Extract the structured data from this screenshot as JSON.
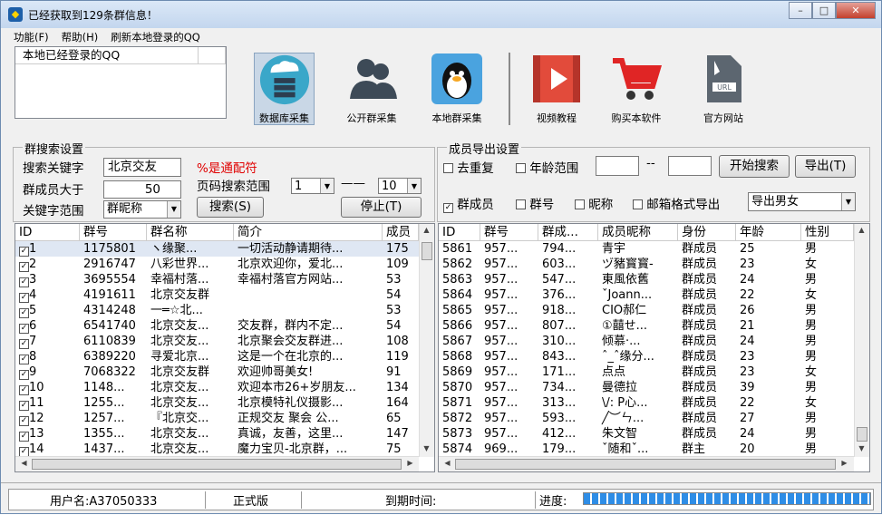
{
  "window": {
    "title": "已经获取到129条群信息！",
    "min": "–",
    "max": "□",
    "close": "✕"
  },
  "menu": [
    "功能(F)",
    "帮助(H)",
    "刷新本地登录的QQ"
  ],
  "logged_header": "本地已经登录的QQ",
  "tools": [
    {
      "label": "数据库采集",
      "icon": "database-cloud-icon"
    },
    {
      "label": "公开群采集",
      "icon": "people-icon"
    },
    {
      "label": "本地群采集",
      "icon": "qq-penguin-icon"
    },
    {
      "label": "视频教程",
      "icon": "video-play-icon"
    },
    {
      "label": "购买本软件",
      "icon": "shopping-cart-icon"
    },
    {
      "label": "官方网站",
      "icon": "url-document-icon"
    }
  ],
  "search": {
    "group_title": "群搜索设置",
    "keyword_label": "搜索关键字",
    "keyword_value": "北京交友",
    "wildcard_note": "%是通配符",
    "members_label": "群成员大于",
    "members_value": "50",
    "page_label": "页码搜索范围",
    "page_from": "1",
    "page_dash": "——",
    "page_to": "10",
    "scope_label": "关键字范围",
    "scope_value": "群昵称",
    "search_btn": "搜索(S)",
    "stop_btn": "停止(T)"
  },
  "export": {
    "group_title": "成员导出设置",
    "dedupe_label": "去重复",
    "age_label": "年龄范围",
    "age_from": "",
    "age_dash": "--",
    "age_to": "",
    "start_btn": "开始搜索",
    "export_btn": "导出(T)",
    "chk_member": "群成员",
    "chk_group": "群号",
    "chk_nick": "昵称",
    "chk_email": "邮箱格式导出",
    "gender_value": "导出男女"
  },
  "left_table": {
    "headers": [
      "ID",
      "群号",
      "群名称",
      "简介",
      "成员"
    ],
    "rows": [
      [
        "1",
        "1175801",
        "ヽ缘聚...",
        "一切活动静请期待...",
        "175"
      ],
      [
        "2",
        "2916747",
        "八彩世界...",
        "北京欢迎你，爱北...",
        "109"
      ],
      [
        "3",
        "3695554",
        "幸福村落...",
        "幸福村落官方网站...",
        "53"
      ],
      [
        "4",
        "4191611",
        "北京交友群",
        "",
        "54"
      ],
      [
        "5",
        "4314248",
        "一═☆北...",
        "",
        "53"
      ],
      [
        "6",
        "6541740",
        "北京交友...",
        "交友群，群内不定...",
        "54"
      ],
      [
        "7",
        "6110839",
        "北京交友...",
        "北京聚会交友群进...",
        "108"
      ],
      [
        "8",
        "6389220",
        "寻爱北京...",
        "这是一个在北京的...",
        "119"
      ],
      [
        "9",
        "7068322",
        "北京交友群",
        "欢迎帅哥美女!",
        "91"
      ],
      [
        "10",
        "1148...",
        "北京交友...",
        "欢迎本市26+岁朋友...",
        "134"
      ],
      [
        "11",
        "1255...",
        "北京交友...",
        "北京模特礼仪摄影...",
        "164"
      ],
      [
        "12",
        "1257...",
        "『北京交...",
        "正规交友 聚会 公...",
        "65"
      ],
      [
        "13",
        "1355...",
        "北京交友...",
        "真诚，友善，这里...",
        "147"
      ],
      [
        "14",
        "1437...",
        "北京交友...",
        "魔力宝贝-北京群，...",
        "75"
      ]
    ]
  },
  "right_table": {
    "headers": [
      "ID",
      "群号",
      "群成...",
      "成员昵称",
      "身份",
      "年龄",
      "性别"
    ],
    "rows": [
      [
        "5861",
        "957...",
        "794...",
        "青宇",
        "群成员",
        "25",
        "男"
      ],
      [
        "5862",
        "957...",
        "603...",
        "ヅ豬寳寳-",
        "群成员",
        "23",
        "女"
      ],
      [
        "5863",
        "957...",
        "547...",
        "東風依舊",
        "群成员",
        "24",
        "男"
      ],
      [
        "5864",
        "957...",
        "376...",
        "ˇJoann...",
        "群成员",
        "22",
        "女"
      ],
      [
        "5865",
        "957...",
        "918...",
        "CIO郝仁",
        "群成员",
        "26",
        "男"
      ],
      [
        "5866",
        "957...",
        "807...",
        "①囍せ...",
        "群成员",
        "21",
        "男"
      ],
      [
        "5867",
        "957...",
        "310...",
        "倾慕·...",
        "群成员",
        "24",
        "男"
      ],
      [
        "5868",
        "957...",
        "843...",
        "ˆ_ˆ缘分...",
        "群成员",
        "23",
        "男"
      ],
      [
        "5869",
        "957...",
        "171...",
        "点点",
        "群成员",
        "23",
        "女"
      ],
      [
        "5870",
        "957...",
        "734...",
        "曼德拉",
        "群成员",
        "39",
        "男"
      ],
      [
        "5871",
        "957...",
        "313...",
        "\\/: P心...",
        "群成员",
        "22",
        "女"
      ],
      [
        "5872",
        "957...",
        "593...",
        "╱︶ㄣ...",
        "群成员",
        "27",
        "男"
      ],
      [
        "5873",
        "957...",
        "412...",
        "朱文智",
        "群成员",
        "24",
        "男"
      ],
      [
        "5874",
        "969...",
        "179...",
        "ˇ随和ˇ...",
        "群主",
        "20",
        "男"
      ]
    ]
  },
  "statusbar": {
    "user": "用户名:A37050333",
    "edition": "正式版",
    "expire": "到期时间:",
    "progress_label": "进度:"
  }
}
